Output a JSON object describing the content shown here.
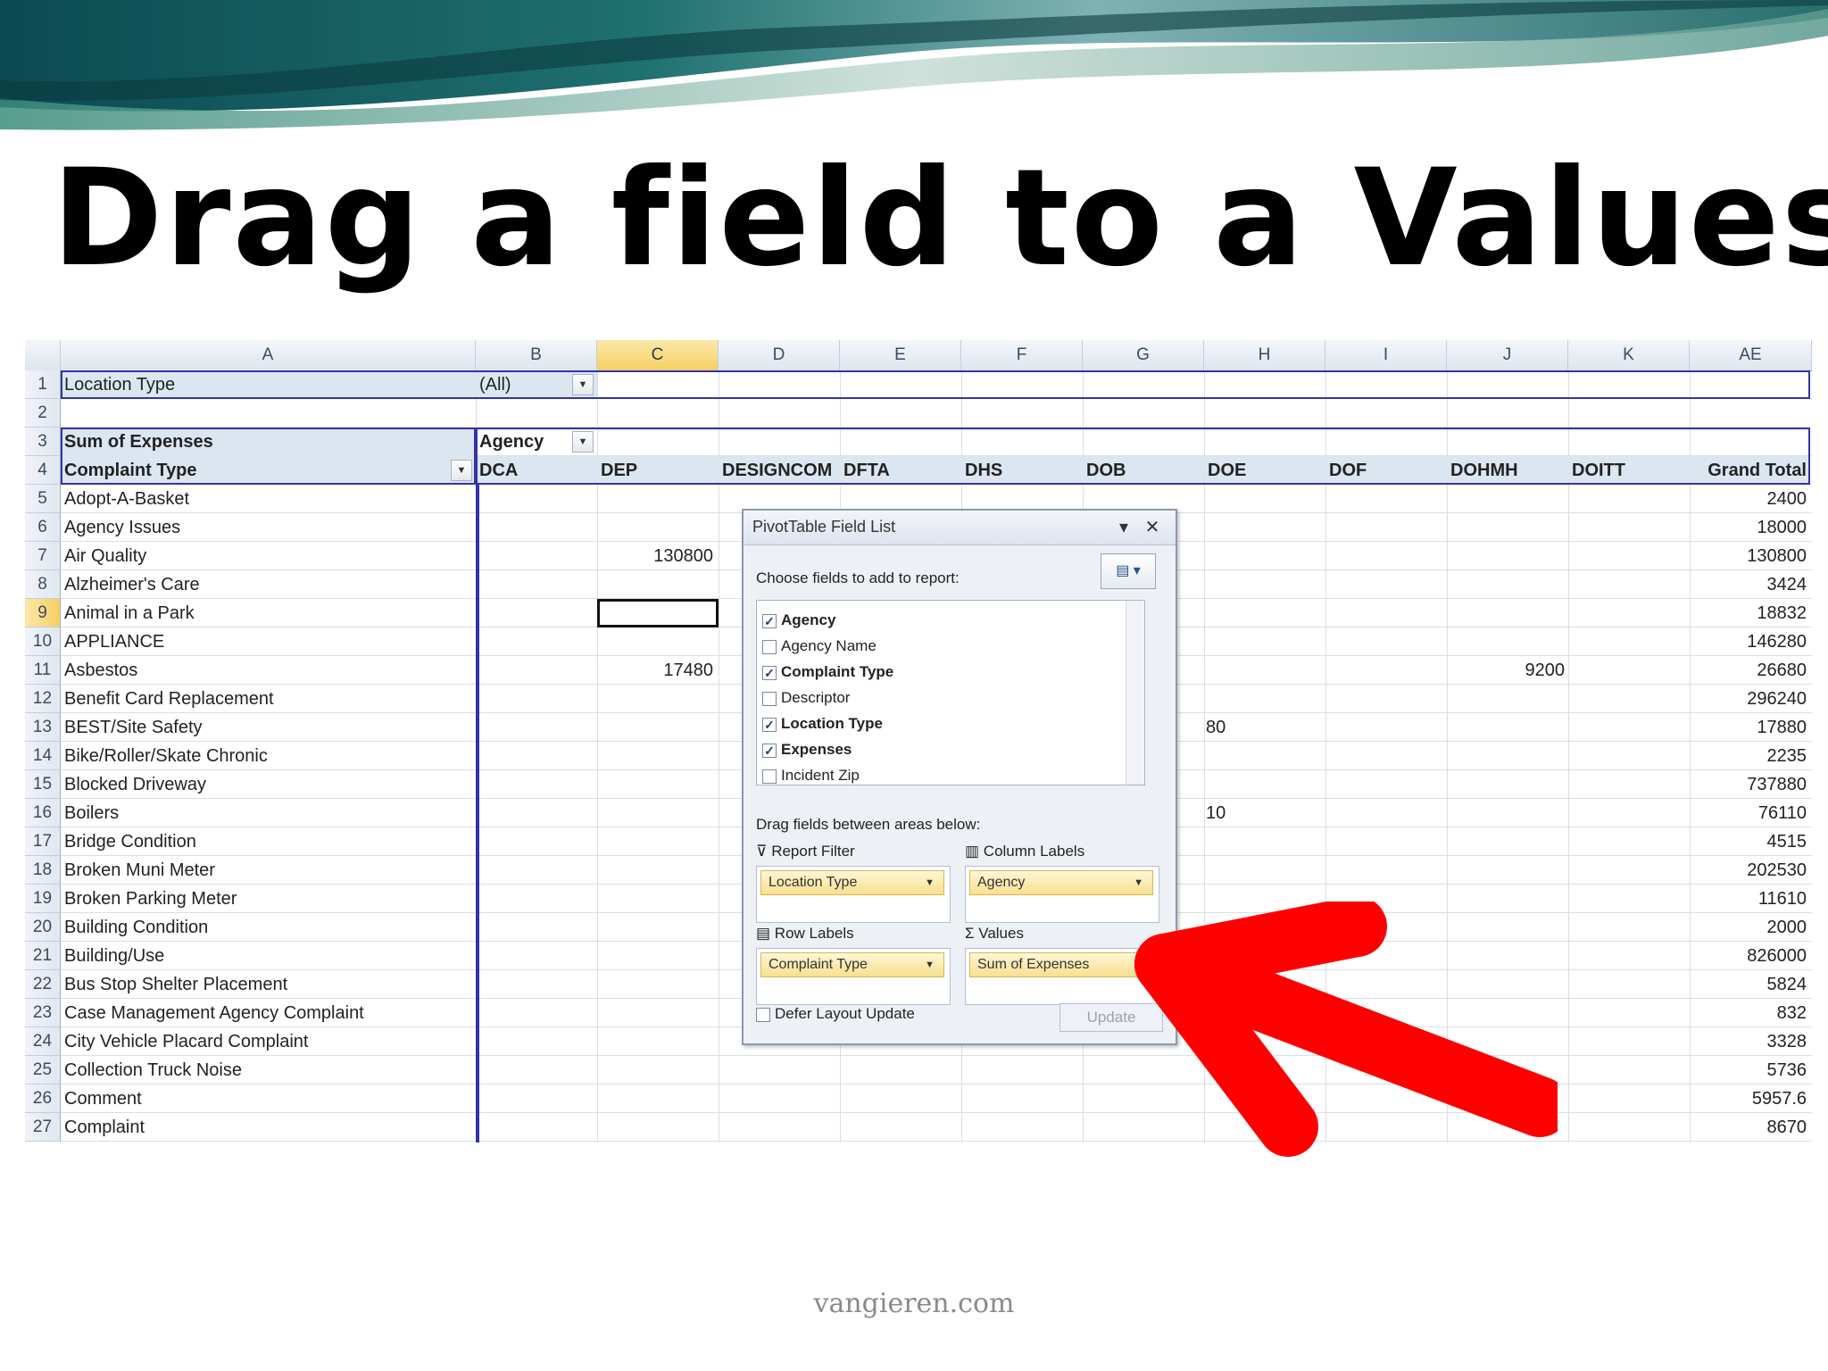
{
  "slide": {
    "title": "Drag a field to a Values",
    "footer": "vangieren.com"
  },
  "sheet": {
    "columns": [
      "A",
      "B",
      "C",
      "D",
      "E",
      "F",
      "G",
      "H",
      "I",
      "J",
      "K",
      "AE"
    ],
    "row1": {
      "label": "Location Type",
      "filter_value": "(All)"
    },
    "row3": {
      "values_label": "Sum of Expenses",
      "col_field": "Agency"
    },
    "row4": {
      "row_field": "Complaint Type",
      "agencies": [
        "DCA",
        "DEP",
        "DESIGNCOM",
        "DFTA",
        "DHS",
        "DOB",
        "DOE",
        "DOF",
        "DOHMH",
        "DOITT"
      ],
      "grand_total": "Grand Total"
    },
    "rows": [
      {
        "num": "5",
        "label": "Adopt-A-Basket",
        "total": "2400"
      },
      {
        "num": "6",
        "label": "Agency Issues",
        "total": "18000"
      },
      {
        "num": "7",
        "label": "Air Quality",
        "dep": "130800",
        "total": "130800"
      },
      {
        "num": "8",
        "label": "Alzheimer's Care",
        "total": "3424"
      },
      {
        "num": "9",
        "label": "Animal in a Park",
        "total": "18832"
      },
      {
        "num": "10",
        "label": "APPLIANCE",
        "total": "146280"
      },
      {
        "num": "11",
        "label": "Asbestos",
        "dep": "17480",
        "dohmh": "9200",
        "total": "26680"
      },
      {
        "num": "12",
        "label": "Benefit Card Replacement",
        "total": "296240"
      },
      {
        "num": "13",
        "label": "BEST/Site Safety",
        "dob": "80",
        "total": "17880"
      },
      {
        "num": "14",
        "label": "Bike/Roller/Skate Chronic",
        "total": "2235"
      },
      {
        "num": "15",
        "label": "Blocked Driveway",
        "total": "737880"
      },
      {
        "num": "16",
        "label": "Boilers",
        "dob": "10",
        "total": "76110"
      },
      {
        "num": "17",
        "label": "Bridge Condition",
        "total": "4515"
      },
      {
        "num": "18",
        "label": "Broken Muni Meter",
        "total": "202530"
      },
      {
        "num": "19",
        "label": "Broken Parking Meter",
        "total": "11610"
      },
      {
        "num": "20",
        "label": "Building Condition",
        "total": "2000"
      },
      {
        "num": "21",
        "label": "Building/Use",
        "total": "826000"
      },
      {
        "num": "22",
        "label": "Bus Stop Shelter Placement",
        "total": "5824"
      },
      {
        "num": "23",
        "label": "Case Management Agency Complaint",
        "total": "832"
      },
      {
        "num": "24",
        "label": "City Vehicle Placard Complaint",
        "total": "3328"
      },
      {
        "num": "25",
        "label": "Collection Truck Noise",
        "total": "5736"
      },
      {
        "num": "26",
        "label": "Comment",
        "total": "5957.6"
      },
      {
        "num": "27",
        "label": "Complaint",
        "total": "8670"
      }
    ]
  },
  "field_list": {
    "title": "PivotTable Field List",
    "prompt": "Choose fields to add to report:",
    "fields": [
      {
        "label": "Agency",
        "checked": "✓"
      },
      {
        "label": "Agency Name",
        "checked": ""
      },
      {
        "label": "Complaint Type",
        "checked": "✓"
      },
      {
        "label": "Descriptor",
        "checked": ""
      },
      {
        "label": "Location Type",
        "checked": "✓"
      },
      {
        "label": "Expenses",
        "checked": "✓"
      },
      {
        "label": "Incident Zip",
        "checked": ""
      }
    ],
    "drag_label": "Drag fields between areas below:",
    "areas": {
      "report_filter": {
        "label": "Report Filter",
        "value": "Location Type"
      },
      "column_labels": {
        "label": "Column Labels",
        "value": "Agency"
      },
      "row_labels": {
        "label": "Row Labels",
        "value": "Complaint Type"
      },
      "values": {
        "label": "Values",
        "value": "Sum of Expenses"
      }
    },
    "defer_label": "Defer Layout Update",
    "update_label": "Update"
  },
  "colors": {
    "arrow": "#ff0000",
    "pivot_border": "#3333aa",
    "band": "#dce6f1",
    "pill": "#f8e08e"
  },
  "icons": {
    "banner": "wave-banner",
    "filter": "funnel-icon",
    "sigma": "sigma-icon"
  }
}
